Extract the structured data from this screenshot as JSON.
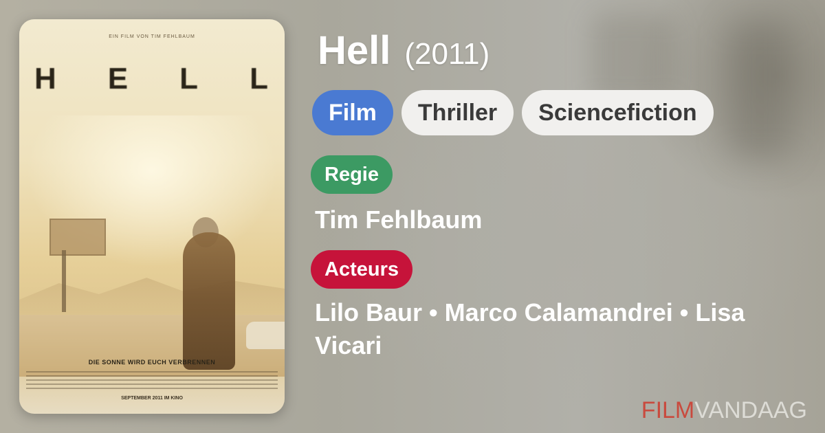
{
  "movie": {
    "title": "Hell",
    "year": "(2011)"
  },
  "poster": {
    "credit_top": "EIN FILM VON TIM FEHLBAUM",
    "title_letters": [
      "H",
      "E",
      "L",
      "L"
    ],
    "tagline": "DIE SONNE WIRD EUCH VERBRENNEN",
    "release": "SEPTEMBER 2011 IM KINO"
  },
  "tags": [
    "Film",
    "Thriller",
    "Sciencefiction"
  ],
  "sections": {
    "regie_label": "Regie",
    "director": "Tim Fehlbaum",
    "acteurs_label": "Acteurs",
    "actors": "Lilo Baur • Marco Calamandrei • Lisa Vicari"
  },
  "brand": {
    "part1": "FILM",
    "part2": "VANDAAG"
  },
  "colors": {
    "tag_primary": "#4a7ad2",
    "regie_badge": "#3c9a63",
    "acteurs_badge": "#c6133a",
    "brand_accent": "#c94a3e"
  }
}
